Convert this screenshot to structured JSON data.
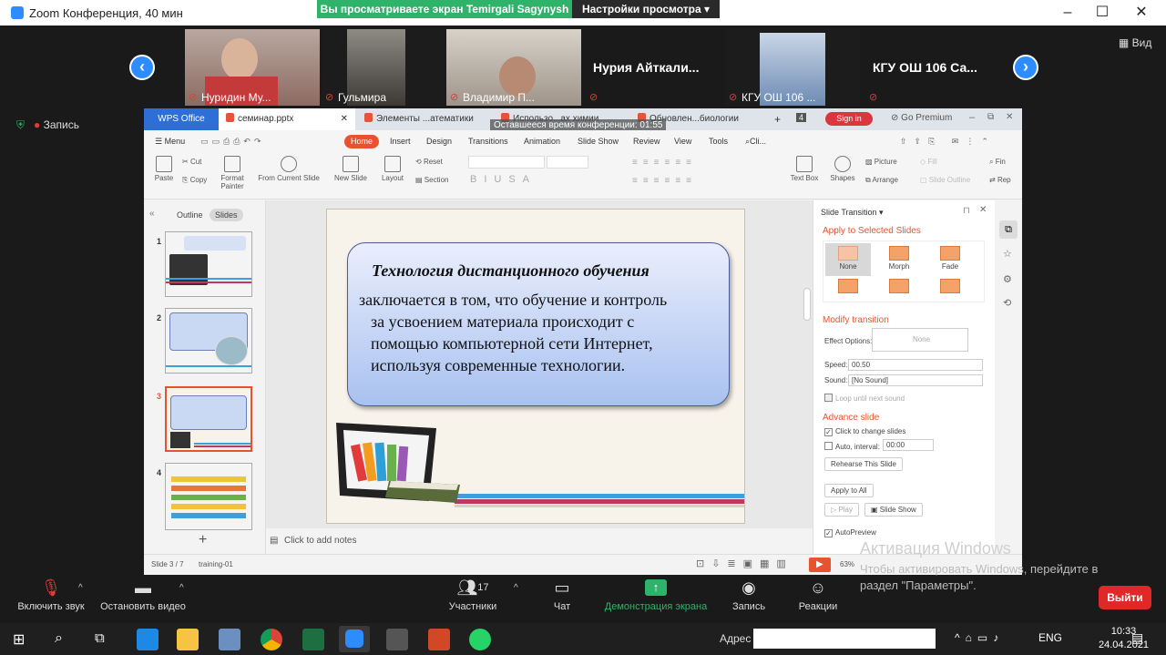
{
  "zoom": {
    "window_title": "Zoom Конференция, 40 мин",
    "share_banner": "Вы просматриваете экран Temirgali Sagynysh",
    "view_settings": "Настройки просмотра",
    "view_button": "Вид",
    "recording_label": "Запись",
    "participants": [
      {
        "name": "Нуридин Му...",
        "video": true
      },
      {
        "name": "Гульмира",
        "video": true
      },
      {
        "name": "Владимир П...",
        "video": true
      },
      {
        "name": "Нурия Айткали...",
        "video": false
      },
      {
        "name": "КГУ ОШ 106 ...",
        "video": true
      },
      {
        "name": "КГУ ОШ 106 Са...",
        "video": false
      }
    ],
    "controls": {
      "mute": "Включить звук",
      "video": "Остановить видео",
      "participants_label": "Участники",
      "participants_count": "17",
      "chat": "Чат",
      "share": "Демонстрация экрана",
      "record": "Запись",
      "reactions": "Реакции",
      "leave": "Выйти"
    },
    "remaining_time": "Оставшееся время конференции: 01:55"
  },
  "wps": {
    "office_tab": "WPS Office",
    "doc_tabs": [
      "семинар.pptx",
      "Элементы ...атематики",
      "Использо...ах химии",
      "Обновлен...биологии"
    ],
    "tab_count": "4",
    "sign_in": "Sign in",
    "go_premium": "Go Premium",
    "menu": [
      "Menu",
      "Home",
      "Insert",
      "Design",
      "Transitions",
      "Animation",
      "Slide Show",
      "Review",
      "View",
      "Tools",
      "Cli..."
    ],
    "ribbon": {
      "paste": "Paste",
      "cut": "Cut",
      "copy": "Copy",
      "format_painter": "Format Painter",
      "from_current": "From Current Slide",
      "new_slide": "New Slide",
      "layout": "Layout",
      "reset": "Reset",
      "section": "Section",
      "text_box": "Text Box",
      "shapes": "Shapes",
      "picture": "Picture",
      "fill": "Fill",
      "arrange": "Arrange",
      "slide_outline": "Slide Outline",
      "find": "Fin",
      "replace": "Rep"
    },
    "pane_tabs": [
      "Outline",
      "Slides"
    ],
    "slide_numbers": [
      "1",
      "2",
      "3",
      "4"
    ],
    "slide": {
      "heading": "Технология дистанционного обучения",
      "line1": "заключается в том, что обучение и контроль",
      "line2": "за усвоением материала происходит с",
      "line3": "помощью компьютерной сети Интернет,",
      "line4": "используя современные технологии."
    },
    "notes_placeholder": "Click to add notes",
    "transition": {
      "title": "Slide Transition",
      "apply_selected": "Apply to Selected Slides",
      "effects": [
        "None",
        "Morph",
        "Fade"
      ],
      "modify": "Modify transition",
      "effect_options_label": "Effect Options:",
      "effect_options_value": "None",
      "speed_label": "Speed:",
      "speed_value": "00.50",
      "sound_label": "Sound:",
      "sound_value": "[No Sound]",
      "loop": "Loop until next sound",
      "advance": "Advance slide",
      "click_change": "Click to change slides",
      "auto_interval": "Auto, interval:",
      "interval_value": "00:00",
      "rehearse": "Rehearse This Slide",
      "apply_all": "Apply to All",
      "play": "Play",
      "slide_show": "Slide Show",
      "autopreview": "AutoPreview"
    },
    "status": {
      "slide_pos": "Slide 3 / 7",
      "theme": "training-01",
      "zoom": "63%"
    }
  },
  "activation": {
    "title": "Активация Windows",
    "text": "Чтобы активировать Windows, перейдите в раздел \"Параметры\"."
  },
  "taskbar": {
    "address_label": "Адрес",
    "lang": "ENG",
    "time": "10:33",
    "date": "24.04.2021"
  }
}
